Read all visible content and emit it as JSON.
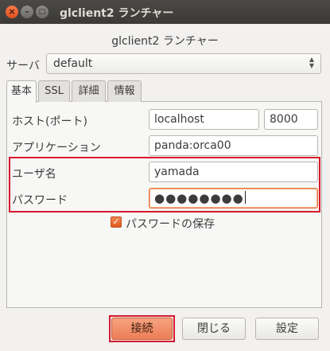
{
  "window": {
    "title": "glclient2 ランチャー",
    "controls": {
      "close": "×",
      "minimize": "–",
      "maximize": "□"
    }
  },
  "header": {
    "title": "glclient2 ランチャー"
  },
  "server": {
    "label": "サーバ",
    "selected": "default",
    "arrows": "▲▼"
  },
  "tabs": [
    {
      "label": "基本",
      "active": true
    },
    {
      "label": "SSL",
      "active": false
    },
    {
      "label": "詳細",
      "active": false
    },
    {
      "label": "情報",
      "active": false
    }
  ],
  "basic": {
    "host_label": "ホスト(ポート)",
    "host_value": "localhost",
    "port_value": "8000",
    "app_label": "アプリケーション",
    "app_value": "panda:orca00",
    "user_label": "ユーザ名",
    "user_value": "yamada",
    "password_label": "パスワード",
    "password_value": "●●●●●●●●",
    "save_password_label": "パスワードの保存",
    "save_password_checked": true,
    "check_mark": "✓"
  },
  "buttons": {
    "connect": "接続",
    "close": "閉じる",
    "settings": "設定"
  },
  "colors": {
    "accent": "#e8753c",
    "highlight_border": "#d6192b",
    "titlebar": "#3c3b37"
  }
}
